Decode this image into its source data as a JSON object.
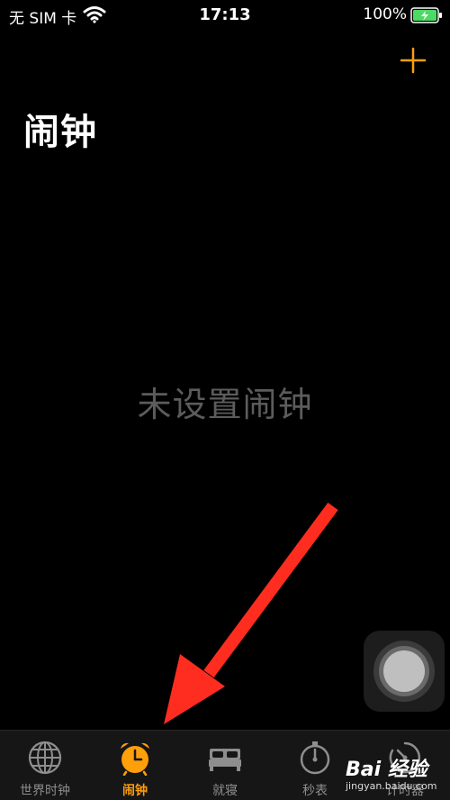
{
  "status_bar": {
    "carrier": "无 SIM 卡",
    "time": "17:13",
    "battery": "100%",
    "battery_color": "#4cd964"
  },
  "accent_color": "#ff9f0a",
  "page_title": "闹钟",
  "empty_message": "未设置闹钟",
  "add_icon": "plus-icon",
  "tabs": [
    {
      "label": "世界时钟",
      "icon": "globe-icon",
      "active": false
    },
    {
      "label": "闹钟",
      "icon": "alarm-clock-icon",
      "active": true
    },
    {
      "label": "就寝",
      "icon": "bed-icon",
      "active": false
    },
    {
      "label": "秒表",
      "icon": "stopwatch-icon",
      "active": false
    },
    {
      "label": "计时器",
      "icon": "timer-icon",
      "active": false
    }
  ],
  "watermark": {
    "text": "Bai 经验",
    "url_text": "jingyan.baidu.com"
  },
  "annotation": {
    "color": "#ff2d20",
    "type": "arrow"
  }
}
